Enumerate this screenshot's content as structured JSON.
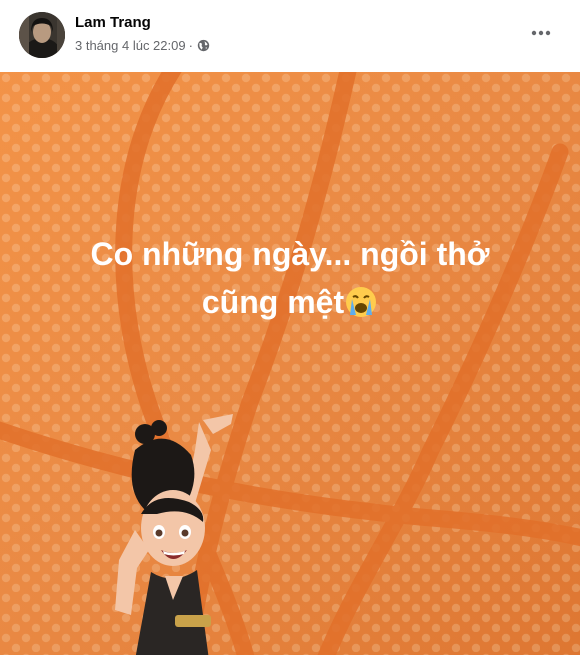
{
  "post": {
    "author_name": "Lam Trang",
    "timestamp": "3 tháng 4 lúc 22:09",
    "separator": "·",
    "privacy_icon": "globe-icon",
    "more_icon": "more-options-icon",
    "status_line1": "Co những ngày... ngồi thở",
    "status_line2": "cũng mệt",
    "status_emoji": "loudly-crying-face-emoji",
    "background": "basketball",
    "background_color": "#F28C3C",
    "dot_color": "#F7B27A",
    "line_color": "#E2702A"
  }
}
